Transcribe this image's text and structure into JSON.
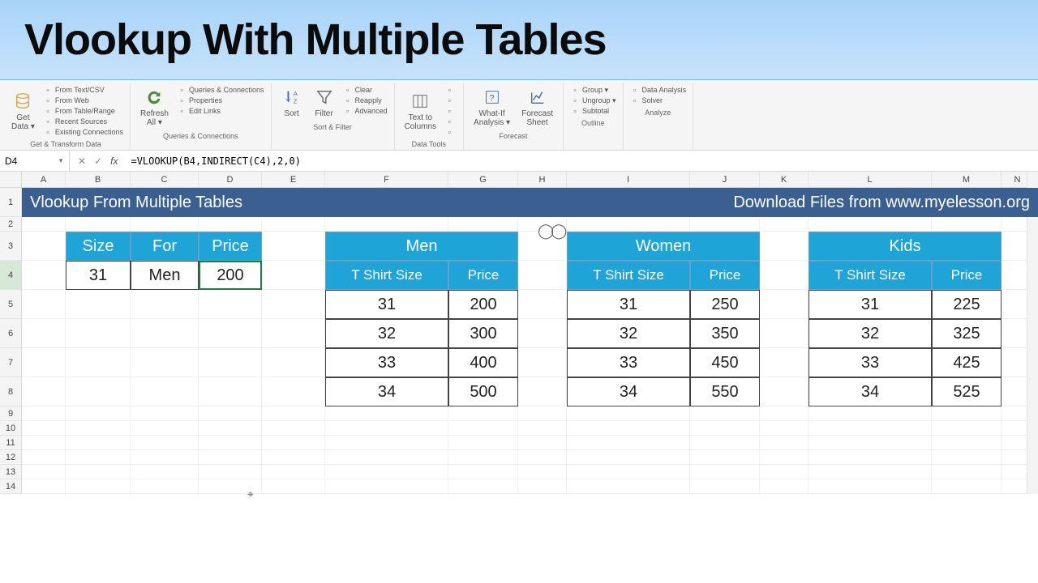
{
  "title": "Vlookup With Multiple Tables",
  "ribbon": {
    "groups": [
      {
        "label": "Get & Transform Data",
        "big": [
          {
            "icon": "db",
            "label": "Get\nData ▾"
          }
        ],
        "small": [
          "From Text/CSV",
          "From Web",
          "From Table/Range",
          "Recent Sources",
          "Existing Connections"
        ]
      },
      {
        "label": "Queries & Connections",
        "big": [
          {
            "icon": "refresh",
            "label": "Refresh\nAll ▾"
          }
        ],
        "small": [
          "Queries & Connections",
          "Properties",
          "Edit Links"
        ]
      },
      {
        "label": "Sort & Filter",
        "big": [
          {
            "icon": "sort",
            "label": "Sort"
          },
          {
            "icon": "filter",
            "label": "Filter"
          }
        ],
        "small": [
          "Clear",
          "Reapply",
          "Advanced"
        ]
      },
      {
        "label": "Data Tools",
        "big": [
          {
            "icon": "ttc",
            "label": "Text to\nColumns"
          }
        ],
        "small": [
          "",
          "",
          "",
          "",
          ""
        ]
      },
      {
        "label": "Forecast",
        "big": [
          {
            "icon": "whatif",
            "label": "What-If\nAnalysis ▾"
          },
          {
            "icon": "fore",
            "label": "Forecast\nSheet"
          }
        ],
        "small": []
      },
      {
        "label": "Outline",
        "big": [],
        "small": [
          "Group ▾",
          "Ungroup ▾",
          "Subtotal"
        ]
      },
      {
        "label": "Analyze",
        "big": [],
        "small": [
          "Data Analysis",
          "Solver"
        ]
      }
    ]
  },
  "formula": {
    "cell": "D4",
    "value": "=VLOOKUP(B4,INDIRECT(C4),2,0)"
  },
  "columns": [
    {
      "l": "A",
      "w": 54
    },
    {
      "l": "B",
      "w": 80
    },
    {
      "l": "C",
      "w": 84
    },
    {
      "l": "D",
      "w": 78
    },
    {
      "l": "E",
      "w": 78
    },
    {
      "l": "F",
      "w": 152
    },
    {
      "l": "G",
      "w": 86
    },
    {
      "l": "H",
      "w": 60
    },
    {
      "l": "I",
      "w": 152
    },
    {
      "l": "J",
      "w": 86
    },
    {
      "l": "K",
      "w": 60
    },
    {
      "l": "L",
      "w": 152
    },
    {
      "l": "M",
      "w": 86
    },
    {
      "l": "N",
      "w": 40
    }
  ],
  "rows": [
    "1",
    "2",
    "3",
    "4",
    "5",
    "6",
    "7",
    "8",
    "9",
    "10",
    "11",
    "12",
    "13",
    "14"
  ],
  "banner": {
    "left": "Vlookup From Multiple Tables",
    "right": "Download Files from www.myelesson.org"
  },
  "lookup": {
    "headers": [
      "Size",
      "For",
      "Price"
    ],
    "values": [
      "31",
      "Men",
      "200"
    ]
  },
  "tables": [
    {
      "title": "Men",
      "h1": "T Shirt Size",
      "h2": "Price",
      "rows": [
        [
          "31",
          "200"
        ],
        [
          "32",
          "300"
        ],
        [
          "33",
          "400"
        ],
        [
          "34",
          "500"
        ]
      ]
    },
    {
      "title": "Women",
      "h1": "T Shirt Size",
      "h2": "Price",
      "rows": [
        [
          "31",
          "250"
        ],
        [
          "32",
          "350"
        ],
        [
          "33",
          "450"
        ],
        [
          "34",
          "550"
        ]
      ]
    },
    {
      "title": "Kids",
      "h1": "T Shirt Size",
      "h2": "Price",
      "rows": [
        [
          "31",
          "225"
        ],
        [
          "32",
          "325"
        ],
        [
          "33",
          "425"
        ],
        [
          "34",
          "525"
        ]
      ]
    }
  ]
}
